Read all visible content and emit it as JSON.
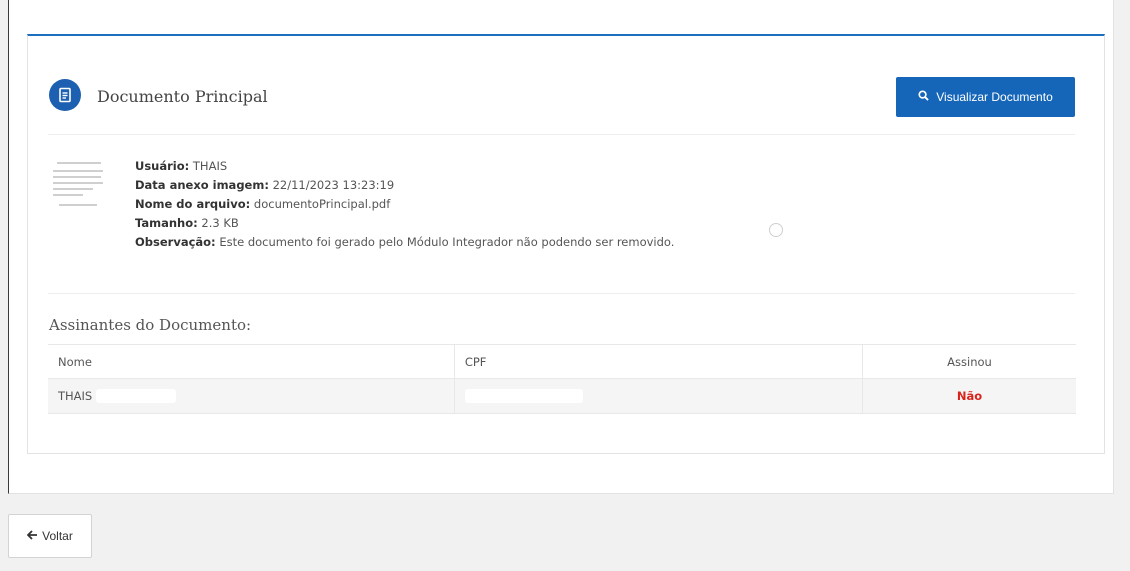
{
  "card": {
    "title": "Documento Principal",
    "view_button_label": "Visualizar Documento",
    "icons": {
      "title": "document-icon",
      "view": "search-icon"
    }
  },
  "document": {
    "user_label": "Usuário:",
    "user_value": "THAIS",
    "date_label": "Data anexo imagem:",
    "date_value": "22/11/2023 13:23:19",
    "filename_label": "Nome do arquivo:",
    "filename_value": "documentoPrincipal.pdf",
    "size_label": "Tamanho:",
    "size_value": "2.3 KB",
    "note_label": "Observação:",
    "note_value": "Este documento foi gerado pelo Módulo Integrador não podendo ser removido."
  },
  "signers": {
    "title": "Assinantes do Documento:",
    "columns": [
      "Nome",
      "CPF",
      "Assinou"
    ],
    "rows": [
      {
        "name": "THAIS",
        "cpf": "",
        "signed": "Não"
      }
    ]
  },
  "footer": {
    "back_label": "Voltar",
    "back_icon": "arrow-left-icon"
  },
  "colors": {
    "accent": "#1566b8",
    "danger": "#d9241c"
  }
}
